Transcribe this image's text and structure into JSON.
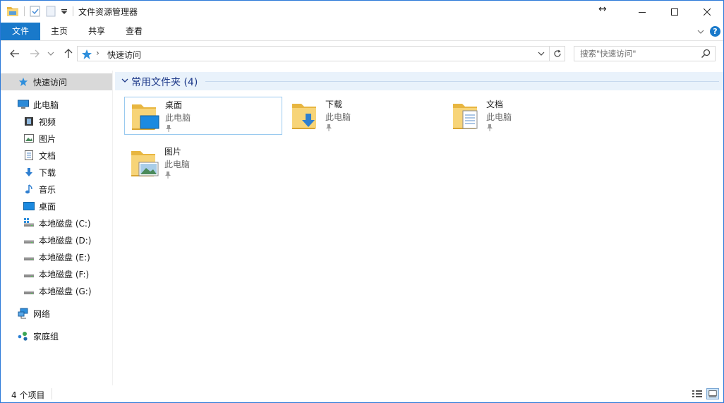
{
  "window": {
    "title": "文件资源管理器",
    "accent": "#1979ca"
  },
  "ribbon": {
    "tabs": [
      {
        "label": "文件"
      },
      {
        "label": "主页"
      },
      {
        "label": "共享"
      },
      {
        "label": "查看"
      }
    ],
    "help_label": "?"
  },
  "navigation": {
    "breadcrumb_separator": "›",
    "address_text": "快速访问",
    "search_placeholder": "搜索\"快速访问\""
  },
  "sidebar": {
    "quick_access": {
      "label": "快速访问",
      "icon": "star-icon"
    },
    "this_pc": {
      "label": "此电脑",
      "icon": "computer-icon"
    },
    "pc_items": [
      {
        "label": "视频",
        "icon": "video-icon"
      },
      {
        "label": "图片",
        "icon": "pictures-icon"
      },
      {
        "label": "文档",
        "icon": "document-icon"
      },
      {
        "label": "下载",
        "icon": "download-icon"
      },
      {
        "label": "音乐",
        "icon": "music-icon"
      },
      {
        "label": "桌面",
        "icon": "desktop-icon"
      },
      {
        "label": "本地磁盘 (C:)",
        "icon": "system-drive-icon"
      },
      {
        "label": "本地磁盘 (D:)",
        "icon": "drive-icon"
      },
      {
        "label": "本地磁盘 (E:)",
        "icon": "drive-icon"
      },
      {
        "label": "本地磁盘 (F:)",
        "icon": "drive-icon"
      },
      {
        "label": "本地磁盘 (G:)",
        "icon": "drive-icon"
      }
    ],
    "network": {
      "label": "网络",
      "icon": "network-icon"
    },
    "homegroup": {
      "label": "家庭组",
      "icon": "homegroup-icon"
    }
  },
  "main": {
    "group_title": "常用文件夹 (4)",
    "folders": [
      {
        "name": "桌面",
        "location": "此电脑",
        "icon": "desktop-folder-icon"
      },
      {
        "name": "下载",
        "location": "此电脑",
        "icon": "downloads-folder-icon"
      },
      {
        "name": "文档",
        "location": "此电脑",
        "icon": "documents-folder-icon"
      },
      {
        "name": "图片",
        "location": "此电脑",
        "icon": "pictures-folder-icon"
      }
    ]
  },
  "status": {
    "item_count": "4 个项目"
  }
}
